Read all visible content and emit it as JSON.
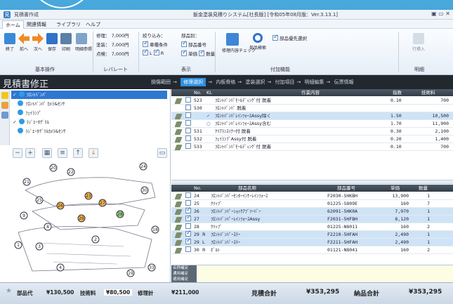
{
  "titlebar": {
    "title": "見積書作成",
    "center": "鈑金塗装見積りシステム[社長版] [令和05年08月版：Ver.3.13.1]",
    "controls": "▣ ▭ ✕"
  },
  "ribbon_tabs": [
    "ホーム",
    "関連情報",
    "ライブラリ",
    "ヘルプ"
  ],
  "ribbon": {
    "basic_ops": {
      "label": "基本操作",
      "buttons": [
        "終了",
        "前へ",
        "次へ",
        "保存",
        "印刷",
        "明細参照"
      ]
    },
    "rates": {
      "label": "レバレート",
      "rows": [
        {
          "k": "修理：",
          "v": "7,000円"
        },
        {
          "k": "塗装：",
          "v": "7,000円"
        },
        {
          "k": "点検：",
          "v": "7,000円"
        }
      ]
    },
    "display": {
      "label": "表示",
      "filter_label": "絞り込み：",
      "filters": [
        "車種条件",
        "L",
        "R"
      ],
      "parts_label": "部品別：",
      "parts": [
        "部品番号",
        "単価",
        "数量"
      ]
    },
    "accessories": {
      "label": "付加機能",
      "buttons": [
        "修理内容チェック",
        "部品検索"
      ],
      "check_label": "部品優先選択"
    },
    "detail": {
      "label": "明細",
      "button": "行挿入"
    }
  },
  "page_title": "見積書修正",
  "steps": [
    "損傷範囲",
    "修理選択",
    "内板骨格",
    "塗装選択",
    "付加項目",
    "明細編集",
    "伝票情報"
  ],
  "current_step": "修理選択",
  "tree": [
    {
      "label": "ﾌﾛﾝﾄﾊﾞﾝﾊﾟ",
      "checked": true,
      "selected": true
    },
    {
      "label": "ﾌﾛﾝﾄﾊﾞﾝﾊﾟ ｶﾒﾗ&ｾﾝｻ",
      "checked": false,
      "selected": false
    },
    {
      "label": "ﾌｪｲﾗﾝﾌﾟ",
      "checked": false,
      "selected": false
    },
    {
      "label": "ﾗｼﾞｴｰﾀｸﾞﾘﾙ",
      "checked": true,
      "selected": false
    },
    {
      "label": "ﾗｼﾞｴｰﾀｸﾞﾘﾙｶﾒﾗ&ｾﾝｻ",
      "checked": false,
      "selected": false
    }
  ],
  "work_table": {
    "headers": [
      "No.",
      "KL",
      "作業内容",
      "指数",
      "技術料"
    ],
    "rows": [
      {
        "no": "523",
        "kl": "",
        "desc": "ﾌﾛﾝﾄﾊﾞﾝﾊﾟﾓｰﾙﾃﾞｨﾝｸﾞ付 脱着",
        "idx": "0.10",
        "fee": "700",
        "hl": false,
        "pen": true
      },
      {
        "no": "530",
        "kl": "",
        "desc": "ﾌﾛﾝﾄﾊﾞﾝﾊﾟ 脱着",
        "idx": "",
        "fee": "",
        "hl": false,
        "pen": false
      },
      {
        "no": "",
        "kl": "✓",
        "desc": "ﾌﾛﾝﾄﾊﾞﾝﾊﾟﾚｲﾝﾌｫｰｽAssy除く",
        "idx": "1.50",
        "fee": "10,500",
        "hl": true,
        "pen": true
      },
      {
        "no": "",
        "kl": "○",
        "desc": "ﾌﾛﾝﾄﾊﾞﾝﾊﾟﾚｲﾝﾌｫｰｽAssy含む",
        "idx": "1.70",
        "fee": "11,900",
        "hl": false,
        "pen": true
      },
      {
        "no": "531",
        "kl": "",
        "desc": "ｸﾘｱﾗﾝｽｿﾅｰ付 脱着",
        "idx": "0.30",
        "fee": "2,100",
        "hl": false,
        "pen": true
      },
      {
        "no": "532",
        "kl": "",
        "desc": "ﾌｪｲﾗﾝﾌﾟAssy付 脱着",
        "idx": "0.20",
        "fee": "1,400",
        "hl": false,
        "pen": true
      },
      {
        "no": "533",
        "kl": "",
        "desc": "ﾌﾛﾝﾄﾊﾞﾝﾊﾟﾓｰﾙﾃﾞｨﾝｸﾞ付 脱着",
        "idx": "0.10",
        "fee": "700",
        "hl": false,
        "pen": true
      }
    ]
  },
  "parts_table": {
    "headers": [
      "No.",
      "部品名称",
      "部品番号",
      "単価",
      "数量"
    ],
    "rows": [
      {
        "chk": false,
        "no": "24",
        "lr": "",
        "name": "ﾌﾛﾝﾄﾊﾞﾝﾊﾟｰｾﾝﾀｰｲﾝﾅｰﾚｲﾝﾌｫｰｽ",
        "pn": "F2030-SHKBH",
        "price": "13,900",
        "qty": "1",
        "hl": false
      },
      {
        "chk": false,
        "no": "25",
        "lr": "",
        "name": "ｸﾘｯﾌﾟ",
        "pn": "01225-S809E",
        "price": "160",
        "qty": "7",
        "hl": false
      },
      {
        "chk": true,
        "no": "26",
        "lr": "",
        "name": "ﾌﾛﾝﾄﾊﾞﾝﾊﾟｰｼｮｯｸｱﾌﾞｿｰﾊﾞｰ",
        "pn": "62091-5HK0A",
        "price": "7,970",
        "qty": "1",
        "hl": true
      },
      {
        "chk": true,
        "no": "27",
        "lr": "",
        "name": "ﾌﾛﾝﾄﾊﾞﾝﾊﾟｰﾚｲﾝﾌｫｰｽAssy",
        "pn": "F2031-5HFBH",
        "price": "8,120",
        "qty": "1",
        "hl": true
      },
      {
        "chk": false,
        "no": "28",
        "lr": "",
        "name": "ｸﾘｯﾌﾟ",
        "pn": "01225-N8011",
        "price": "160",
        "qty": "2",
        "hl": false
      },
      {
        "chk": true,
        "no": "29",
        "lr": "R",
        "name": "ﾌﾛﾝﾄﾊﾞﾝﾊﾟｰｽﾃｰ",
        "pn": "F2210-5HFAH",
        "price": "2,490",
        "qty": "1",
        "hl": true
      },
      {
        "chk": true,
        "no": "29",
        "lr": "L",
        "name": "ﾌﾛﾝﾄﾊﾞﾝﾊﾟｰｽﾃｰ",
        "pn": "F2211-5HFAH",
        "price": "2,490",
        "qty": "1",
        "hl": true
      },
      {
        "chk": false,
        "no": "30",
        "lr": "R",
        "name": "ﾎﾞﾙﾄ",
        "pn": "01121-N8041",
        "price": "160",
        "qty": "2",
        "hl": false
      }
    ]
  },
  "notes_labels": [
    "名称補足",
    "通用補足",
    "適用補足"
  ],
  "diagram_labels": [
    "20",
    "21",
    "22",
    "23",
    "24",
    "25",
    "26",
    "27",
    "28",
    "29",
    "30",
    "33",
    "8",
    "9",
    "3",
    "4",
    "1",
    "2",
    "19",
    "18"
  ],
  "footer": {
    "parts_label": "部品代",
    "parts_value": "¥130,500",
    "tech_label": "技術料",
    "tech_value": "¥80,500",
    "repair_label": "修理計",
    "repair_value": "¥211,000",
    "estimate_label": "見積合計",
    "estimate_value": "¥353,295",
    "delivery_label": "納品合計",
    "delivery_value": "¥353,295"
  }
}
